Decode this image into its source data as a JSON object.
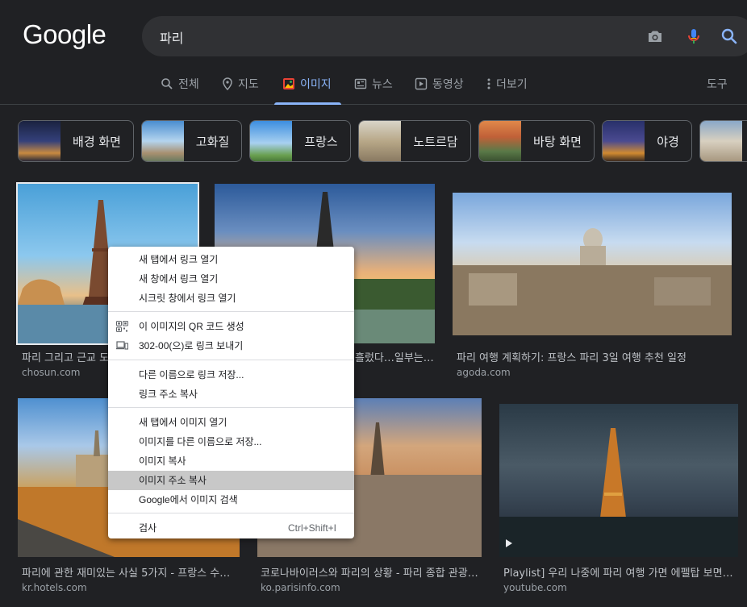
{
  "header": {
    "logo": "Google",
    "search_value": "파리",
    "icons": [
      "camera-icon",
      "mic-icon",
      "search-icon"
    ]
  },
  "tabs": {
    "all": "전체",
    "maps": "지도",
    "images": "이미지",
    "news": "뉴스",
    "videos": "동영상",
    "more": "더보기",
    "tools": "도구"
  },
  "chips": [
    {
      "label": "배경 화면"
    },
    {
      "label": "고화질"
    },
    {
      "label": "프랑스"
    },
    {
      "label": "노트르담"
    },
    {
      "label": "바탕 화면"
    },
    {
      "label": "야경"
    }
  ],
  "results": [
    {
      "caption": "파리 그리고 근교 도",
      "source": "chosun.com"
    },
    {
      "caption": "흘렀다…일부는 …",
      "source": ""
    },
    {
      "caption": "파리 여행 계획하기: 프랑스 파리 3일 여행 추천 일정",
      "source": "agoda.com"
    },
    {
      "caption": "파리에 관한 재미있는 사실 5가지 - 프랑스 수…",
      "source": "kr.hotels.com"
    },
    {
      "caption": "코로나바이러스와 파리의 상황 - 파리 종합 관광…",
      "source": "ko.parisinfo.com"
    },
    {
      "caption": "Playlist] 우리 나중에 파리 여행 가면 에펠탑 보면…",
      "source": "youtube.com"
    }
  ],
  "context_menu": {
    "items": [
      {
        "label": "새 탭에서 링크 열기"
      },
      {
        "label": "새 창에서 링크 열기"
      },
      {
        "label": "시크릿 창에서 링크 열기"
      },
      {
        "label": "이 이미지의 QR 코드 생성"
      },
      {
        "label": "302-00(으)로 링크 보내기"
      },
      {
        "label": "다른 이름으로 링크 저장..."
      },
      {
        "label": "링크 주소 복사"
      },
      {
        "label": "새 탭에서 이미지 열기"
      },
      {
        "label": "이미지를 다른 이름으로 저장..."
      },
      {
        "label": "이미지 복사"
      },
      {
        "label": "이미지 주소 복사"
      },
      {
        "label": "Google에서 이미지 검색"
      },
      {
        "label": "검사",
        "shortcut": "Ctrl+Shift+I"
      }
    ],
    "highlighted": "이미지 주소 복사"
  },
  "colors": {
    "background": "#202124",
    "accent": "#8ab4f8",
    "search_box": "#303134"
  }
}
